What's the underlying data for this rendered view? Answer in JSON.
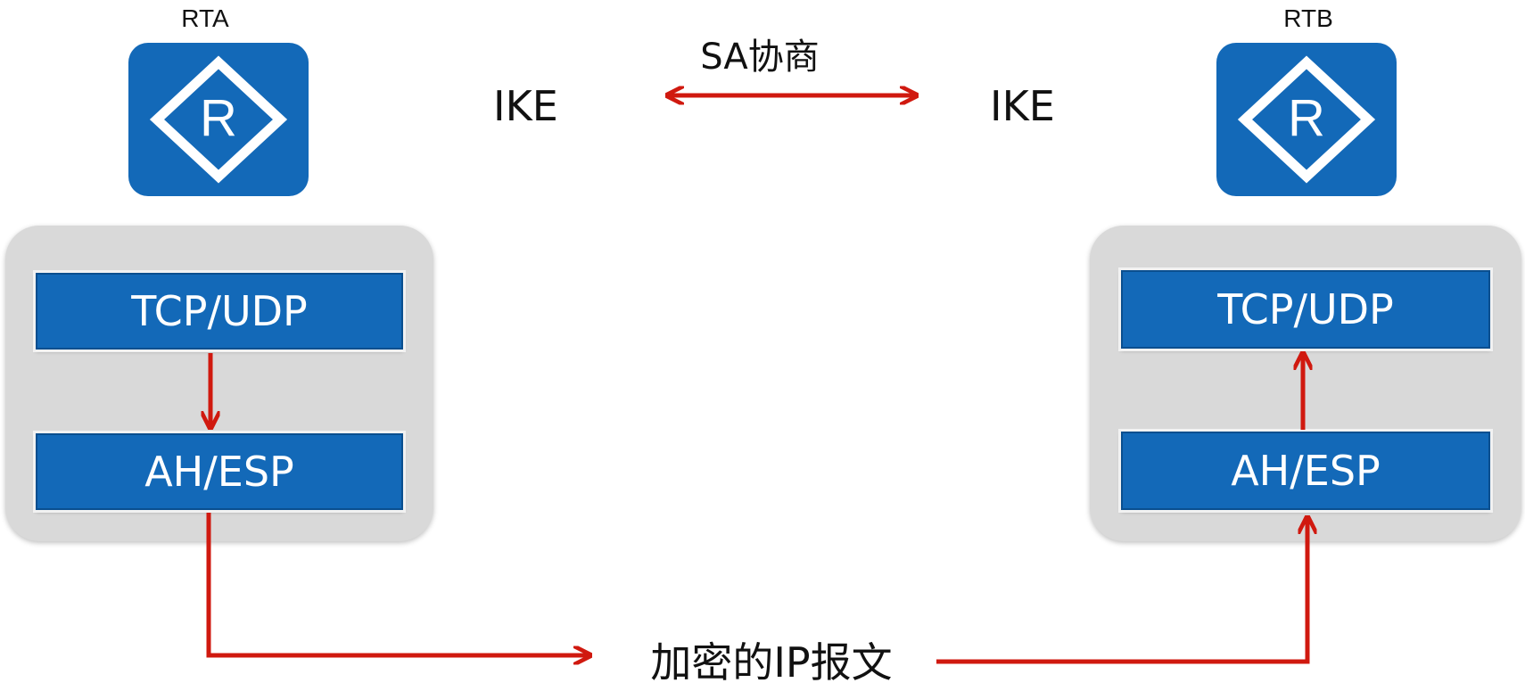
{
  "routers": {
    "left": {
      "label": "RTA",
      "icon_letter": "R"
    },
    "right": {
      "label": "RTB",
      "icon_letter": "R"
    }
  },
  "ike": {
    "left_label": "IKE",
    "right_label": "IKE",
    "negotiation_label": "SA协商"
  },
  "stacks": {
    "left": {
      "upper_layer": "TCP/UDP",
      "lower_layer": "AH/ESP"
    },
    "right": {
      "upper_layer": "TCP/UDP",
      "lower_layer": "AH/ESP"
    }
  },
  "packet_label": "加密的IP报文",
  "colors": {
    "router_blue": "#1369b8",
    "layer_blue": "#1369b8",
    "panel_gray": "#d9d9d9",
    "arrow_red": "#d0190f"
  }
}
